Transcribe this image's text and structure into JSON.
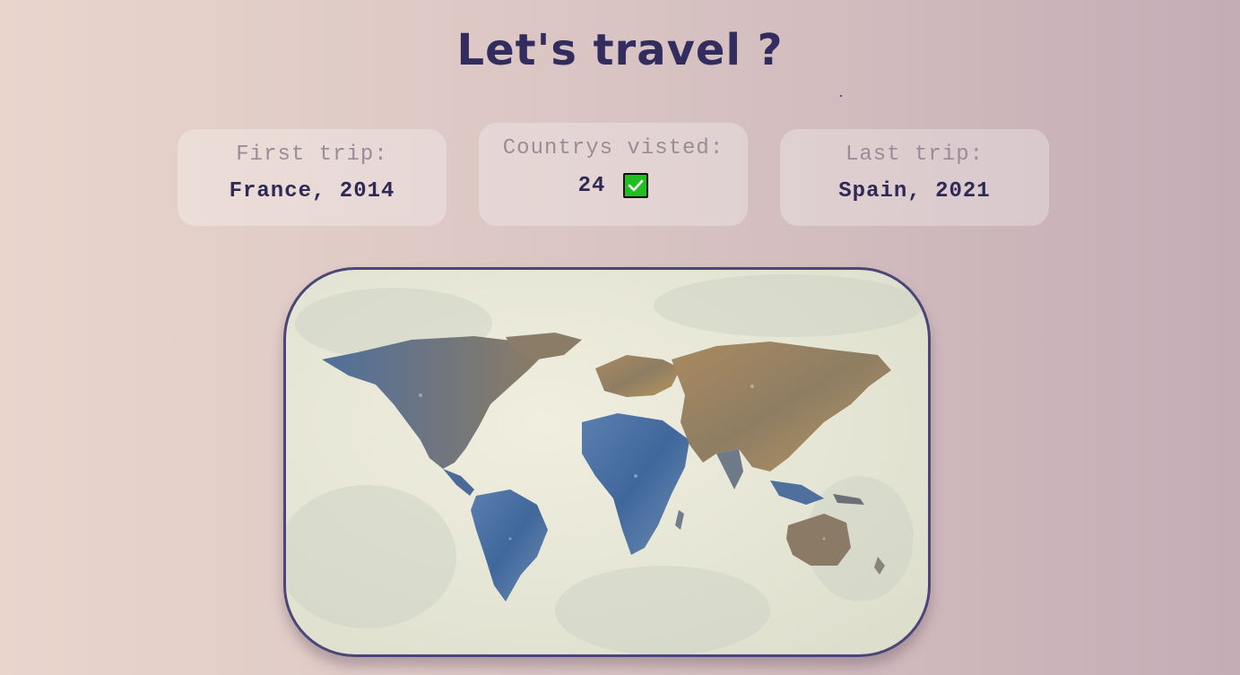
{
  "header": {
    "title": "Let's travel ?"
  },
  "stats": {
    "first_trip": {
      "label": "First trip:",
      "value": "France, 2014"
    },
    "countries": {
      "label": "Countrys visted:",
      "value": "24",
      "icon": "check-mark-icon"
    },
    "last_trip": {
      "label": "Last trip:",
      "value": "Spain, 2021"
    }
  },
  "map": {
    "icon": "world-map-image"
  },
  "colors": {
    "title": "#322d5e",
    "label": "#9a8c96",
    "value": "#2f2a55",
    "check": "#1fbf1f",
    "map_border": "#4a4677"
  }
}
